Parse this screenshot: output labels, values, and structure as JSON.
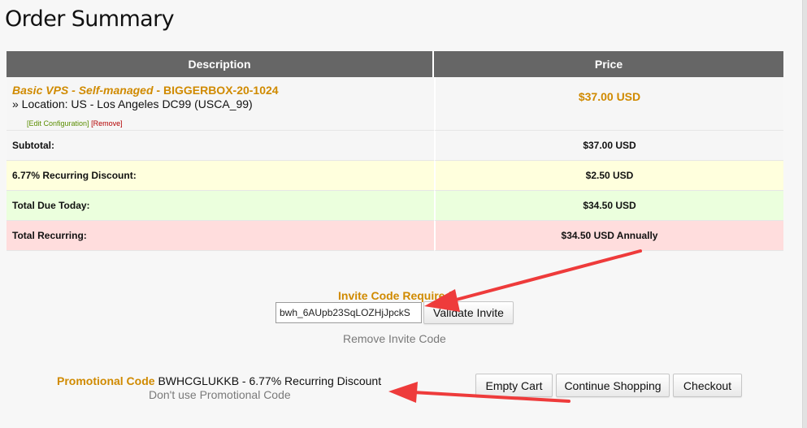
{
  "page": {
    "title": "Order Summary"
  },
  "table": {
    "headers": {
      "description": "Description",
      "price": "Price"
    },
    "product": {
      "name": "Basic VPS - Self-managed",
      "separator": " - ",
      "hostname": "BIGGERBOX-20-1024",
      "location": "» Location: US - Los Angeles DC99 (USCA_99)",
      "price": "$37.00 USD",
      "edit_link": "[Edit Configuration]",
      "remove_link": "[Remove]"
    },
    "summary": [
      {
        "label": "Subtotal:",
        "value": "$37.00 USD",
        "tone": "plain"
      },
      {
        "label": "6.77% Recurring Discount:",
        "value": "$2.50 USD",
        "tone": "yellow"
      },
      {
        "label": "Total Due Today:",
        "value": "$34.50 USD",
        "tone": "green"
      },
      {
        "label": "Total Recurring:",
        "value": "$34.50 USD Annually",
        "tone": "red"
      }
    ]
  },
  "invite": {
    "label": "Invite Code Required",
    "input_value": "bwh_6AUpb23SqLOZHjJpckS",
    "validate_button": "Validate Invite",
    "remove_link": "Remove Invite Code"
  },
  "promo": {
    "label": "Promotional Code",
    "code_text": "BWHCGLUKKB - 6.77% Recurring Discount",
    "dont_use": "Don't use Promotional Code"
  },
  "buttons": {
    "empty_cart": "Empty Cart",
    "continue_shopping": "Continue Shopping",
    "checkout": "Checkout"
  },
  "colors": {
    "accent": "#d08a00",
    "header_bg": "#666666",
    "discount_bg": "#ffffdd",
    "today_bg": "#ebffdd",
    "recurring_bg": "#ffdddd",
    "annotation_arrow": "#ee3b3b"
  }
}
